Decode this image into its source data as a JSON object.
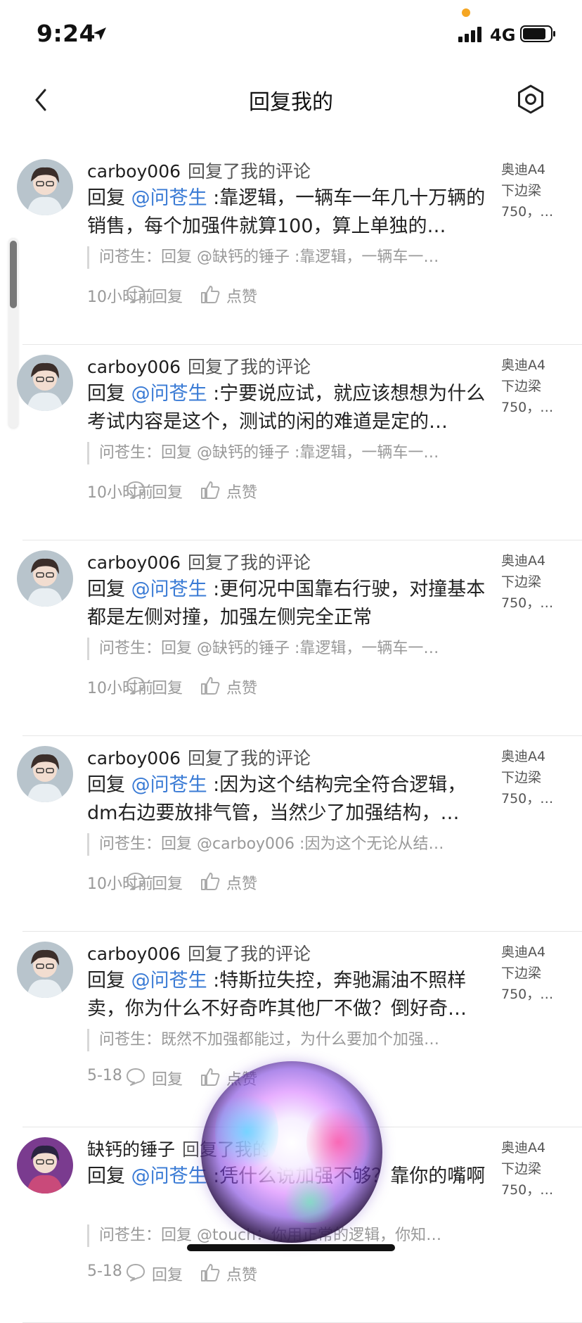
{
  "status_bar": {
    "time": "9:24",
    "network": "4G"
  },
  "nav": {
    "title": "回复我的"
  },
  "items": [
    {
      "user": "carboy006",
      "action": "回复了我的评论",
      "reply_prefix": "回复 ",
      "mention": "@问苍生",
      "text": " :靠逻辑，一辆车一年几十万辆的销售，每个加强件就算100，算上单独的…",
      "quote": "问苍生：回复 @缺钙的锤子 :靠逻辑，一辆车一…",
      "time": "10小时前",
      "reply_label": "回复",
      "like_label": "点赞",
      "side": [
        "奥迪A4",
        "下边梁",
        "750，…"
      ]
    },
    {
      "user": "carboy006",
      "action": "回复了我的评论",
      "reply_prefix": "回复 ",
      "mention": "@问苍生",
      "text": " :宁要说应试，就应该想想为什么考试内容是这个，测试的闲的难道是定的…",
      "quote": "问苍生：回复 @缺钙的锤子 :靠逻辑，一辆车一…",
      "time": "10小时前",
      "reply_label": "回复",
      "like_label": "点赞",
      "side": [
        "奥迪A4",
        "下边梁",
        "750，…"
      ]
    },
    {
      "user": "carboy006",
      "action": "回复了我的评论",
      "reply_prefix": "回复 ",
      "mention": "@问苍生",
      "text": " :更何况中国靠右行驶，对撞基本都是左侧对撞，加强左侧完全正常",
      "quote": "问苍生：回复 @缺钙的锤子 :靠逻辑，一辆车一…",
      "time": "10小时前",
      "reply_label": "回复",
      "like_label": "点赞",
      "side": [
        "奥迪A4",
        "下边梁",
        "750，…"
      ]
    },
    {
      "user": "carboy006",
      "action": "回复了我的评论",
      "reply_prefix": "回复 ",
      "mention": "@问苍生",
      "text": " :因为这个结构完全符合逻辑，dm右边要放排气管，当然少了加强结构，…",
      "quote": "问苍生：回复 @carboy006 :因为这个无论从结…",
      "time": "10小时前",
      "reply_label": "回复",
      "like_label": "点赞",
      "side": [
        "奥迪A4",
        "下边梁",
        "750，…"
      ]
    },
    {
      "user": "carboy006",
      "action": "回复了我的评论",
      "reply_prefix": "回复 ",
      "mention": "@问苍生",
      "text": " :特斯拉失控，奔驰漏油不照样卖，你为什么不好奇咋其他厂不做？倒好奇…",
      "quote": "问苍生：既然不加强都能过，为什么要加个加强…",
      "time": "5-18",
      "reply_label": "回复",
      "like_label": "点赞",
      "side": [
        "奥迪A4",
        "下边梁",
        "750，…"
      ]
    },
    {
      "user": "缺钙的锤子",
      "action": "回复了我的评论",
      "reply_prefix": "回复 ",
      "mention": "@问苍生",
      "text": " :凭什么说加强不够？靠你的嘴啊",
      "quote": "问苍生：回复 @touch：你用正常的逻辑，你知…",
      "time": "5-18",
      "reply_label": "回复",
      "like_label": "点赞",
      "side": [
        "奥迪A4",
        "下边梁",
        "750，…"
      ]
    }
  ],
  "icons": {
    "location": "location-arrow-icon",
    "signal": "signal-icon",
    "battery": "battery-icon",
    "back": "back-chevron-icon",
    "settings": "settings-icon",
    "comment": "comment-icon",
    "like": "thumbs-up-icon"
  },
  "colors": {
    "mention": "#3a7bd5",
    "muted": "#999999",
    "accent_dot": "#f5a623"
  }
}
